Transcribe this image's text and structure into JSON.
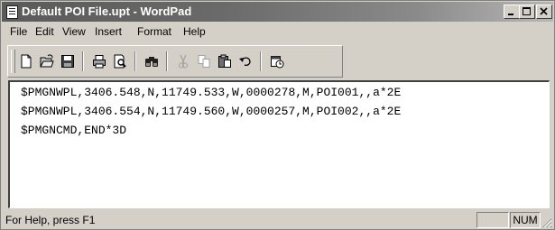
{
  "window": {
    "title": "Default POI File.upt - WordPad",
    "controls": [
      "minimize",
      "maximize",
      "close"
    ]
  },
  "menu": {
    "items": [
      "File",
      "Edit",
      "View",
      "Insert",
      "Format",
      "Help"
    ]
  },
  "toolbar": {
    "buttons": [
      {
        "name": "new",
        "icon": "new-document-icon"
      },
      {
        "name": "open",
        "icon": "open-folder-icon"
      },
      {
        "name": "save",
        "icon": "save-disk-icon"
      },
      {
        "name": "print",
        "icon": "printer-icon"
      },
      {
        "name": "print-preview",
        "icon": "print-preview-icon"
      },
      {
        "name": "find",
        "icon": "binoculars-icon"
      },
      {
        "name": "cut",
        "icon": "scissors-icon",
        "enabled": false
      },
      {
        "name": "copy",
        "icon": "copy-icon",
        "enabled": false
      },
      {
        "name": "paste",
        "icon": "paste-icon"
      },
      {
        "name": "undo",
        "icon": "undo-icon"
      },
      {
        "name": "date-time",
        "icon": "date-time-icon"
      }
    ]
  },
  "document": {
    "lines": [
      "$PMGNWPL,3406.548,N,11749.533,W,0000278,M,POI001,,a*2E",
      "$PMGNWPL,3406.554,N,11749.560,W,0000257,M,POI002,,a*2E",
      "$PMGNCMD,END*3D"
    ]
  },
  "status": {
    "help_text": "For Help, press F1",
    "num_indicator": "NUM"
  }
}
